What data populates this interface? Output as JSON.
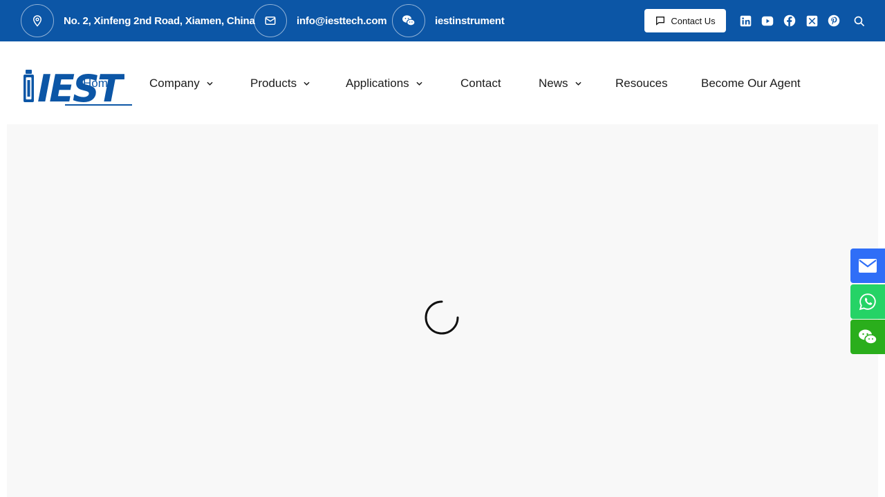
{
  "topbar": {
    "address": "No. 2, Xinfeng 2nd Road, Xiamen, China",
    "email": "info@iesttech.com",
    "wechat": "iestinstrument",
    "contact_button": "Contact Us",
    "social_icons": [
      "linkedin-icon",
      "youtube-icon",
      "facebook-icon",
      "x-icon",
      "pinterest-icon",
      "search-icon"
    ]
  },
  "brand": {
    "logo_text": "IEST"
  },
  "nav": {
    "home": "Home",
    "items": [
      {
        "label": "Company",
        "dropdown": true
      },
      {
        "label": "Products",
        "dropdown": true
      },
      {
        "label": "Applications",
        "dropdown": true
      },
      {
        "label": "Contact",
        "dropdown": false
      },
      {
        "label": "News",
        "dropdown": true
      },
      {
        "label": "Resouces",
        "dropdown": false
      },
      {
        "label": "Become Our Agent",
        "dropdown": false
      }
    ]
  },
  "side_buttons": [
    "email-icon",
    "whatsapp-icon",
    "wechat-icon"
  ],
  "colors": {
    "brand_blue": "#0c56a6",
    "email_blue": "#2f6ef7",
    "whatsapp_green": "#25d366",
    "wechat_green": "#2aae1c",
    "content_bg": "#f8f8f8"
  }
}
